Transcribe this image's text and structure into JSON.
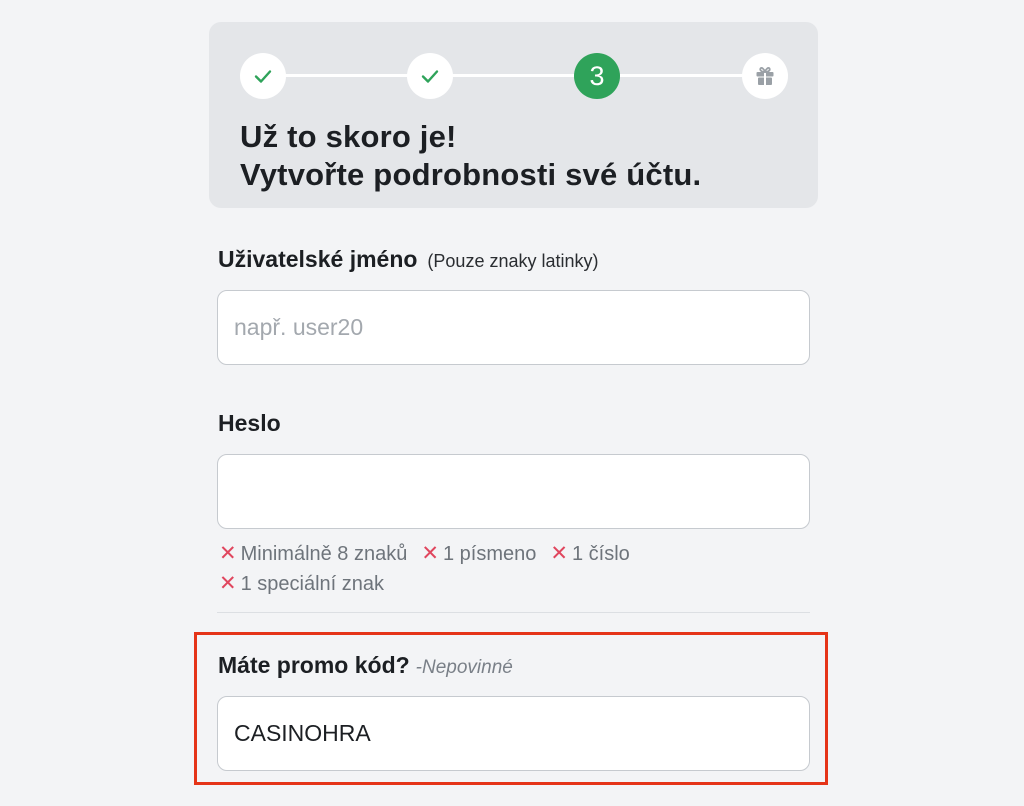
{
  "stepper": {
    "steps": [
      {
        "state": "done",
        "icon": "check-icon"
      },
      {
        "state": "done",
        "icon": "check-icon"
      },
      {
        "state": "active",
        "number": "3"
      },
      {
        "state": "pending",
        "icon": "gift-icon"
      }
    ],
    "check_color": "#2fa35a",
    "active_color": "#2fa35a"
  },
  "header": {
    "line1": "Už to skoro je!",
    "line2": "Vytvořte podrobnosti své účtu."
  },
  "username": {
    "label": "Uživatelské jméno",
    "note": "(Pouze znaky latinky)",
    "placeholder": "např. user20",
    "value": ""
  },
  "password": {
    "label": "Heslo",
    "value": "",
    "rules": [
      "Minimálně 8 znaků",
      "1 písmeno",
      "1 číslo",
      "1 speciální znak"
    ],
    "rule_icon": "x-icon",
    "rule_icon_color": "#e0465e"
  },
  "promo": {
    "label": "Máte promo kód?",
    "optional": "-Nepovinné",
    "value": "CASINOHRA",
    "highlight_color": "#e53418"
  }
}
